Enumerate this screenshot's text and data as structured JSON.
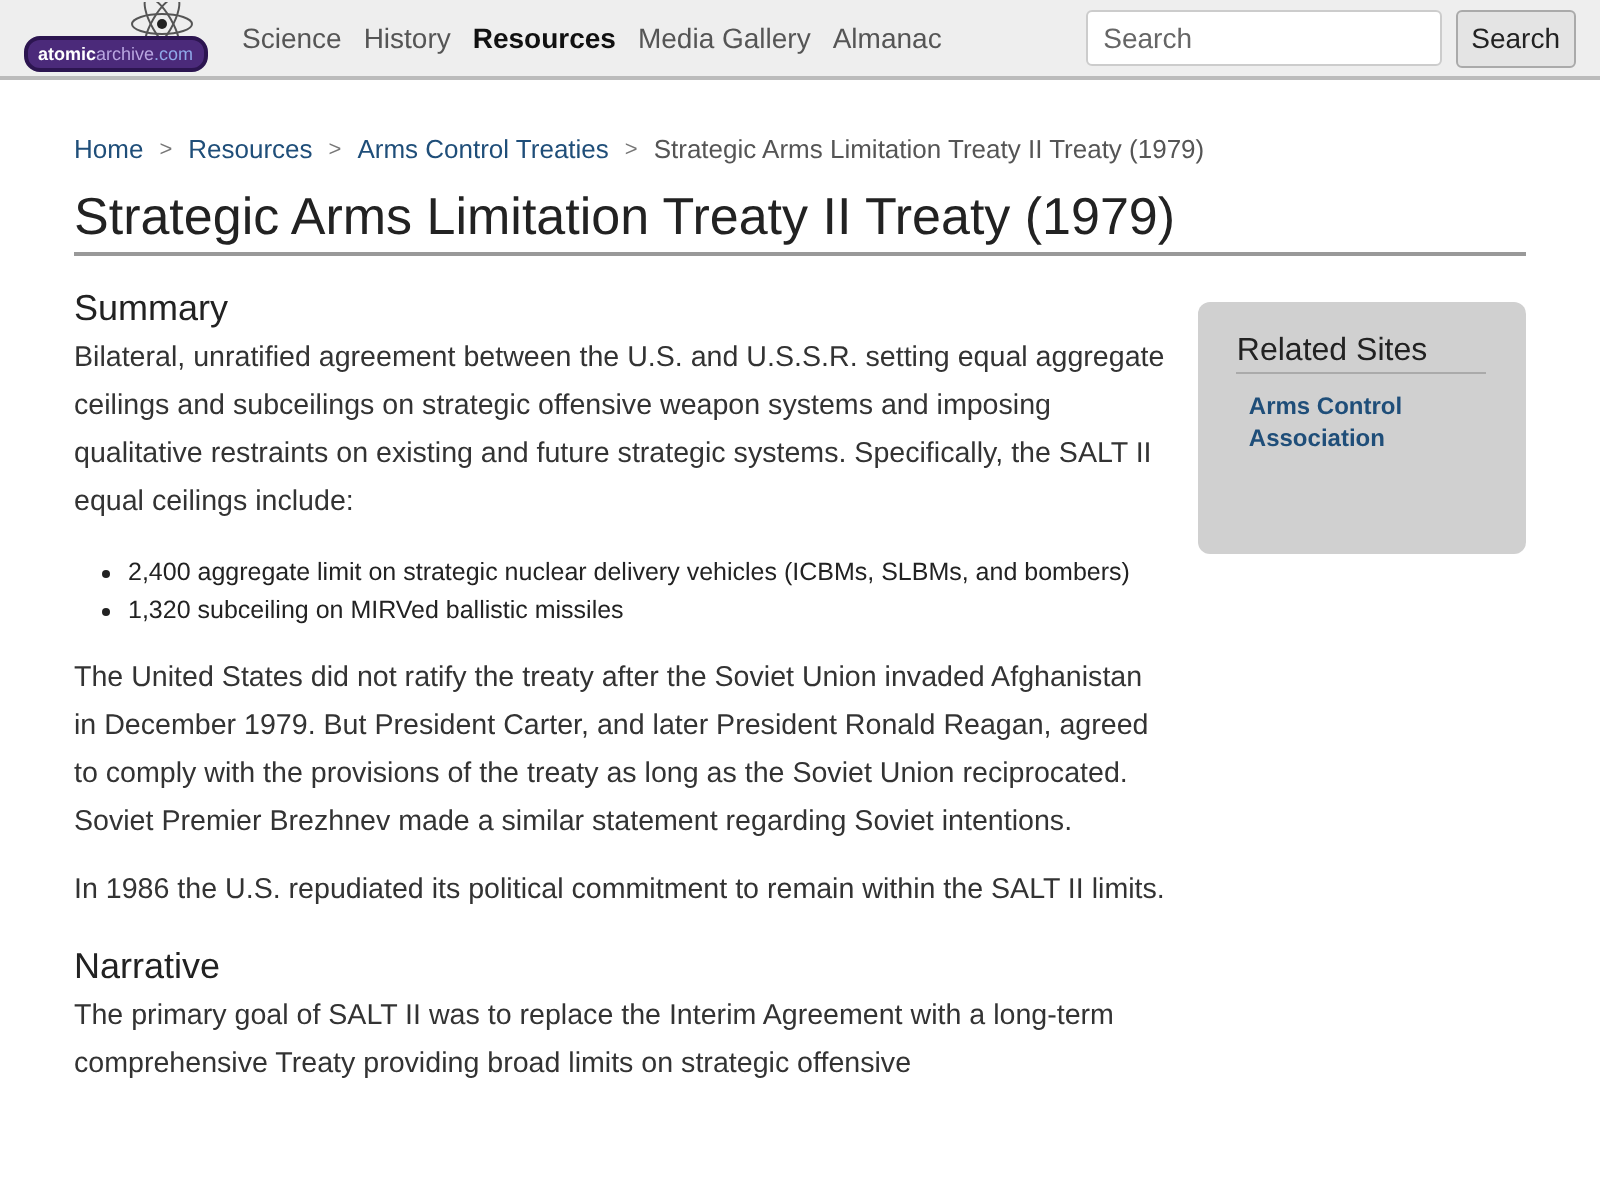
{
  "header": {
    "logo": {
      "parts": [
        "atomic",
        "archive",
        ".com"
      ]
    },
    "nav": [
      {
        "label": "Science",
        "selected": false
      },
      {
        "label": "History",
        "selected": false
      },
      {
        "label": "Resources",
        "selected": true
      },
      {
        "label": "Media Gallery",
        "selected": false
      },
      {
        "label": "Almanac",
        "selected": false
      }
    ],
    "search": {
      "placeholder": "Search",
      "button": "Search"
    }
  },
  "breadcrumbs": [
    {
      "label": "Home",
      "link": true
    },
    {
      "label": "Resources",
      "link": true
    },
    {
      "label": "Arms Control Treaties",
      "link": true
    },
    {
      "label": "Strategic Arms Limitation Treaty II Treaty (1979)",
      "link": false
    }
  ],
  "breadcrumb_separator": ">",
  "title": "Strategic Arms Limitation Treaty II Treaty (1979)",
  "sections": [
    {
      "kind": "heading",
      "text": "Summary"
    },
    {
      "kind": "paragraph",
      "text": "Bilateral, unratified agreement between the U.S. and U.S.S.R. setting equal aggregate ceilings and subceilings on strategic offensive weapon systems and imposing qualitative restraints on existing and future strategic systems. Specifically, the SALT II equal ceilings include:"
    },
    {
      "kind": "list",
      "items": [
        "2,400 aggregate limit on strategic nuclear delivery vehicles (ICBMs, SLBMs, and bombers)",
        "1,320 subceiling on MIRVed ballistic missiles"
      ]
    },
    {
      "kind": "paragraph",
      "text": "The United States did not ratify the treaty after the Soviet Union invaded Afghanistan in December 1979. But President Carter, and later President Ronald Reagan, agreed to comply with the provisions of the treaty as long as the Soviet Union reciprocated. Soviet Premier Brezhnev made a similar statement regarding Soviet intentions."
    },
    {
      "kind": "paragraph",
      "text": "In 1986 the U.S. repudiated its political commitment to remain within the SALT II limits."
    },
    {
      "kind": "heading",
      "text": "Narrative"
    },
    {
      "kind": "paragraph",
      "text": "The primary goal of SALT II was to replace the Interim Agreement with a long-term comprehensive Treaty providing broad limits on strategic offensive"
    }
  ],
  "sidebar": {
    "title": "Related Sites",
    "links": [
      "Arms Control Association"
    ]
  }
}
